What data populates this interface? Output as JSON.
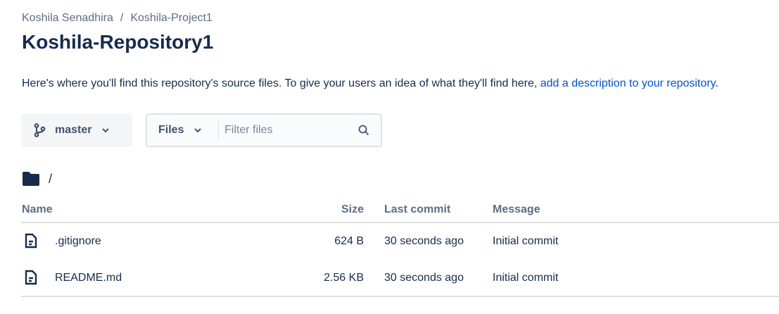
{
  "breadcrumb": [
    "Koshila Senadhira",
    "Koshila-Project1"
  ],
  "breadcrumb_sep": "/",
  "title": "Koshila-Repository1",
  "description": {
    "text": "Here's where you'll find this repository's source files. To give your users an idea of what they'll find here, ",
    "link": "add a description to your repository",
    "end": "."
  },
  "branch": {
    "label": "master"
  },
  "filter": {
    "type_label": "Files",
    "placeholder": "Filter files"
  },
  "path": "/",
  "table": {
    "headers": {
      "name": "Name",
      "size": "Size",
      "last_commit": "Last commit",
      "message": "Message"
    },
    "rows": [
      {
        "name": ".gitignore",
        "size": "624 B",
        "last_commit": "30 seconds ago",
        "message": "Initial commit"
      },
      {
        "name": "README.md",
        "size": "2.56 KB",
        "last_commit": "30 seconds ago",
        "message": "Initial commit"
      }
    ]
  }
}
